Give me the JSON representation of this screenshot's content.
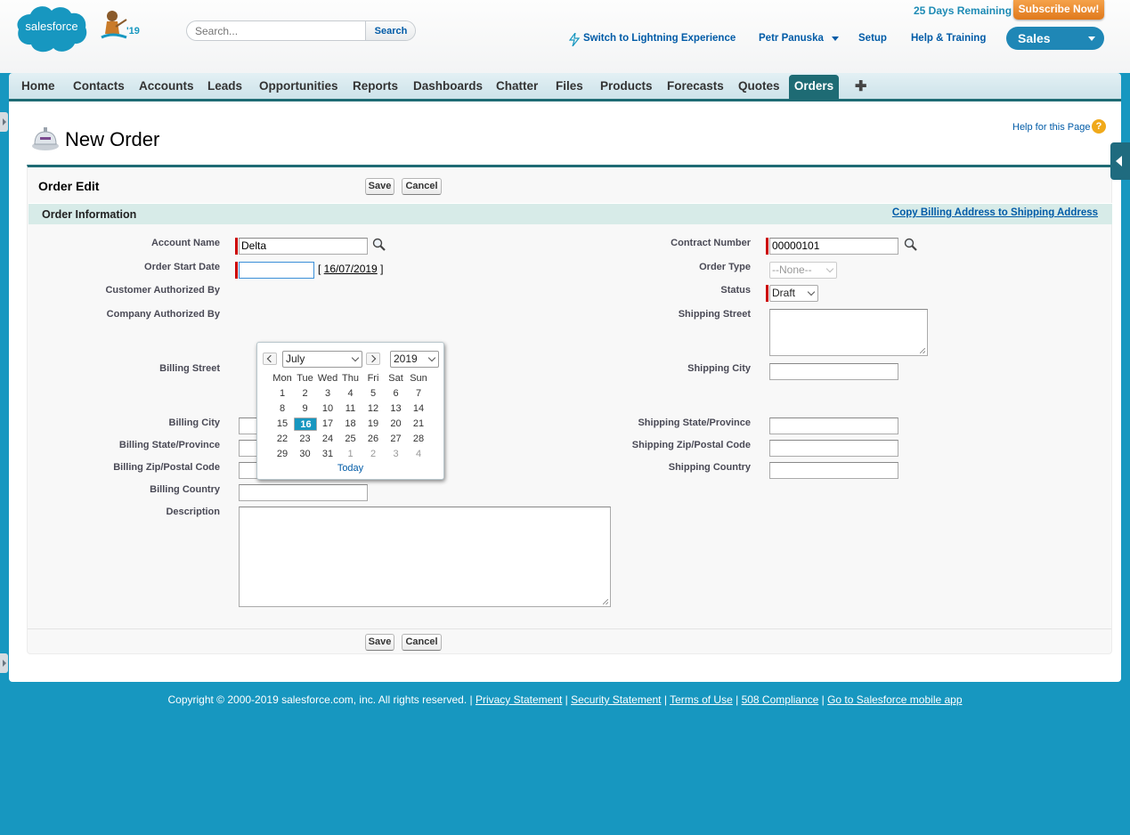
{
  "header": {
    "logo_text": "salesforce",
    "release_badge": "'19",
    "search": {
      "placeholder": "Search...",
      "value": "",
      "button_label": "Search"
    },
    "trial_text": "25 Days Remaining",
    "subscribe_label": "Subscribe Now!",
    "lightning_label": "Switch to Lightning Experience",
    "user_name": "Petr Panuska",
    "setup_label": "Setup",
    "help_label": "Help & Training",
    "app_name": "Sales"
  },
  "tabs": [
    "Home",
    "Contacts",
    "Accounts",
    "Leads",
    "Opportunities",
    "Reports",
    "Dashboards",
    "Chatter",
    "Files",
    "Products",
    "Forecasts",
    "Quotes"
  ],
  "active_tab": "Orders",
  "page": {
    "title": "New Order",
    "help_link": "Help for this Page",
    "help_icon": "?"
  },
  "form": {
    "edit_title": "Order Edit",
    "save_label": "Save",
    "cancel_label": "Cancel",
    "section_title": "Order Information",
    "copy_link": "Copy Billing Address to Shipping Address",
    "left_fields": {
      "account_name": {
        "label": "Account Name",
        "value": "Delta"
      },
      "order_start_date": {
        "label": "Order Start Date",
        "value": "",
        "date_link": "16/07/2019"
      },
      "customer_authorized_by": {
        "label": "Customer Authorized By"
      },
      "company_authorized_by": {
        "label": "Company Authorized By"
      },
      "billing_street": {
        "label": "Billing Street"
      },
      "billing_city": {
        "label": "Billing City",
        "value": ""
      },
      "billing_state": {
        "label": "Billing State/Province",
        "value": ""
      },
      "billing_zip": {
        "label": "Billing Zip/Postal Code",
        "value": ""
      },
      "billing_country": {
        "label": "Billing Country",
        "value": ""
      },
      "description": {
        "label": "Description"
      }
    },
    "right_fields": {
      "contract_number": {
        "label": "Contract Number",
        "value": "00000101"
      },
      "order_type": {
        "label": "Order Type",
        "value": "--None--"
      },
      "status": {
        "label": "Status",
        "value": "Draft"
      },
      "shipping_street": {
        "label": "Shipping Street"
      },
      "shipping_city": {
        "label": "Shipping City",
        "value": ""
      },
      "shipping_state": {
        "label": "Shipping State/Province",
        "value": ""
      },
      "shipping_zip": {
        "label": "Shipping Zip/Postal Code",
        "value": ""
      },
      "shipping_country": {
        "label": "Shipping Country",
        "value": ""
      }
    }
  },
  "calendar": {
    "month": "July",
    "year": "2019",
    "weekdays": [
      "Mon",
      "Tue",
      "Wed",
      "Thu",
      "Fri",
      "Sat",
      "Sun"
    ],
    "weeks": [
      [
        "1",
        "2",
        "3",
        "4",
        "5",
        "6",
        "7"
      ],
      [
        "8",
        "9",
        "10",
        "11",
        "12",
        "13",
        "14"
      ],
      [
        "15",
        "16",
        "17",
        "18",
        "19",
        "20",
        "21"
      ],
      [
        "22",
        "23",
        "24",
        "25",
        "26",
        "27",
        "28"
      ],
      [
        "29",
        "30",
        "31",
        "1",
        "2",
        "3",
        "4"
      ]
    ],
    "selected_day": "16",
    "today_label": "Today"
  },
  "footer": {
    "copyright": "Copyright © 2000-2019 salesforce.com, inc. All rights reserved. |",
    "links": [
      "Privacy Statement",
      "Security Statement",
      "Terms of Use",
      "508 Compliance",
      "Go to Salesforce mobile app"
    ]
  },
  "colors": {
    "brand": "#1797c0",
    "tab_active": "#1e6b74",
    "link": "#015ba7",
    "subscribe": "#e0791c",
    "required": "#cc0000"
  }
}
